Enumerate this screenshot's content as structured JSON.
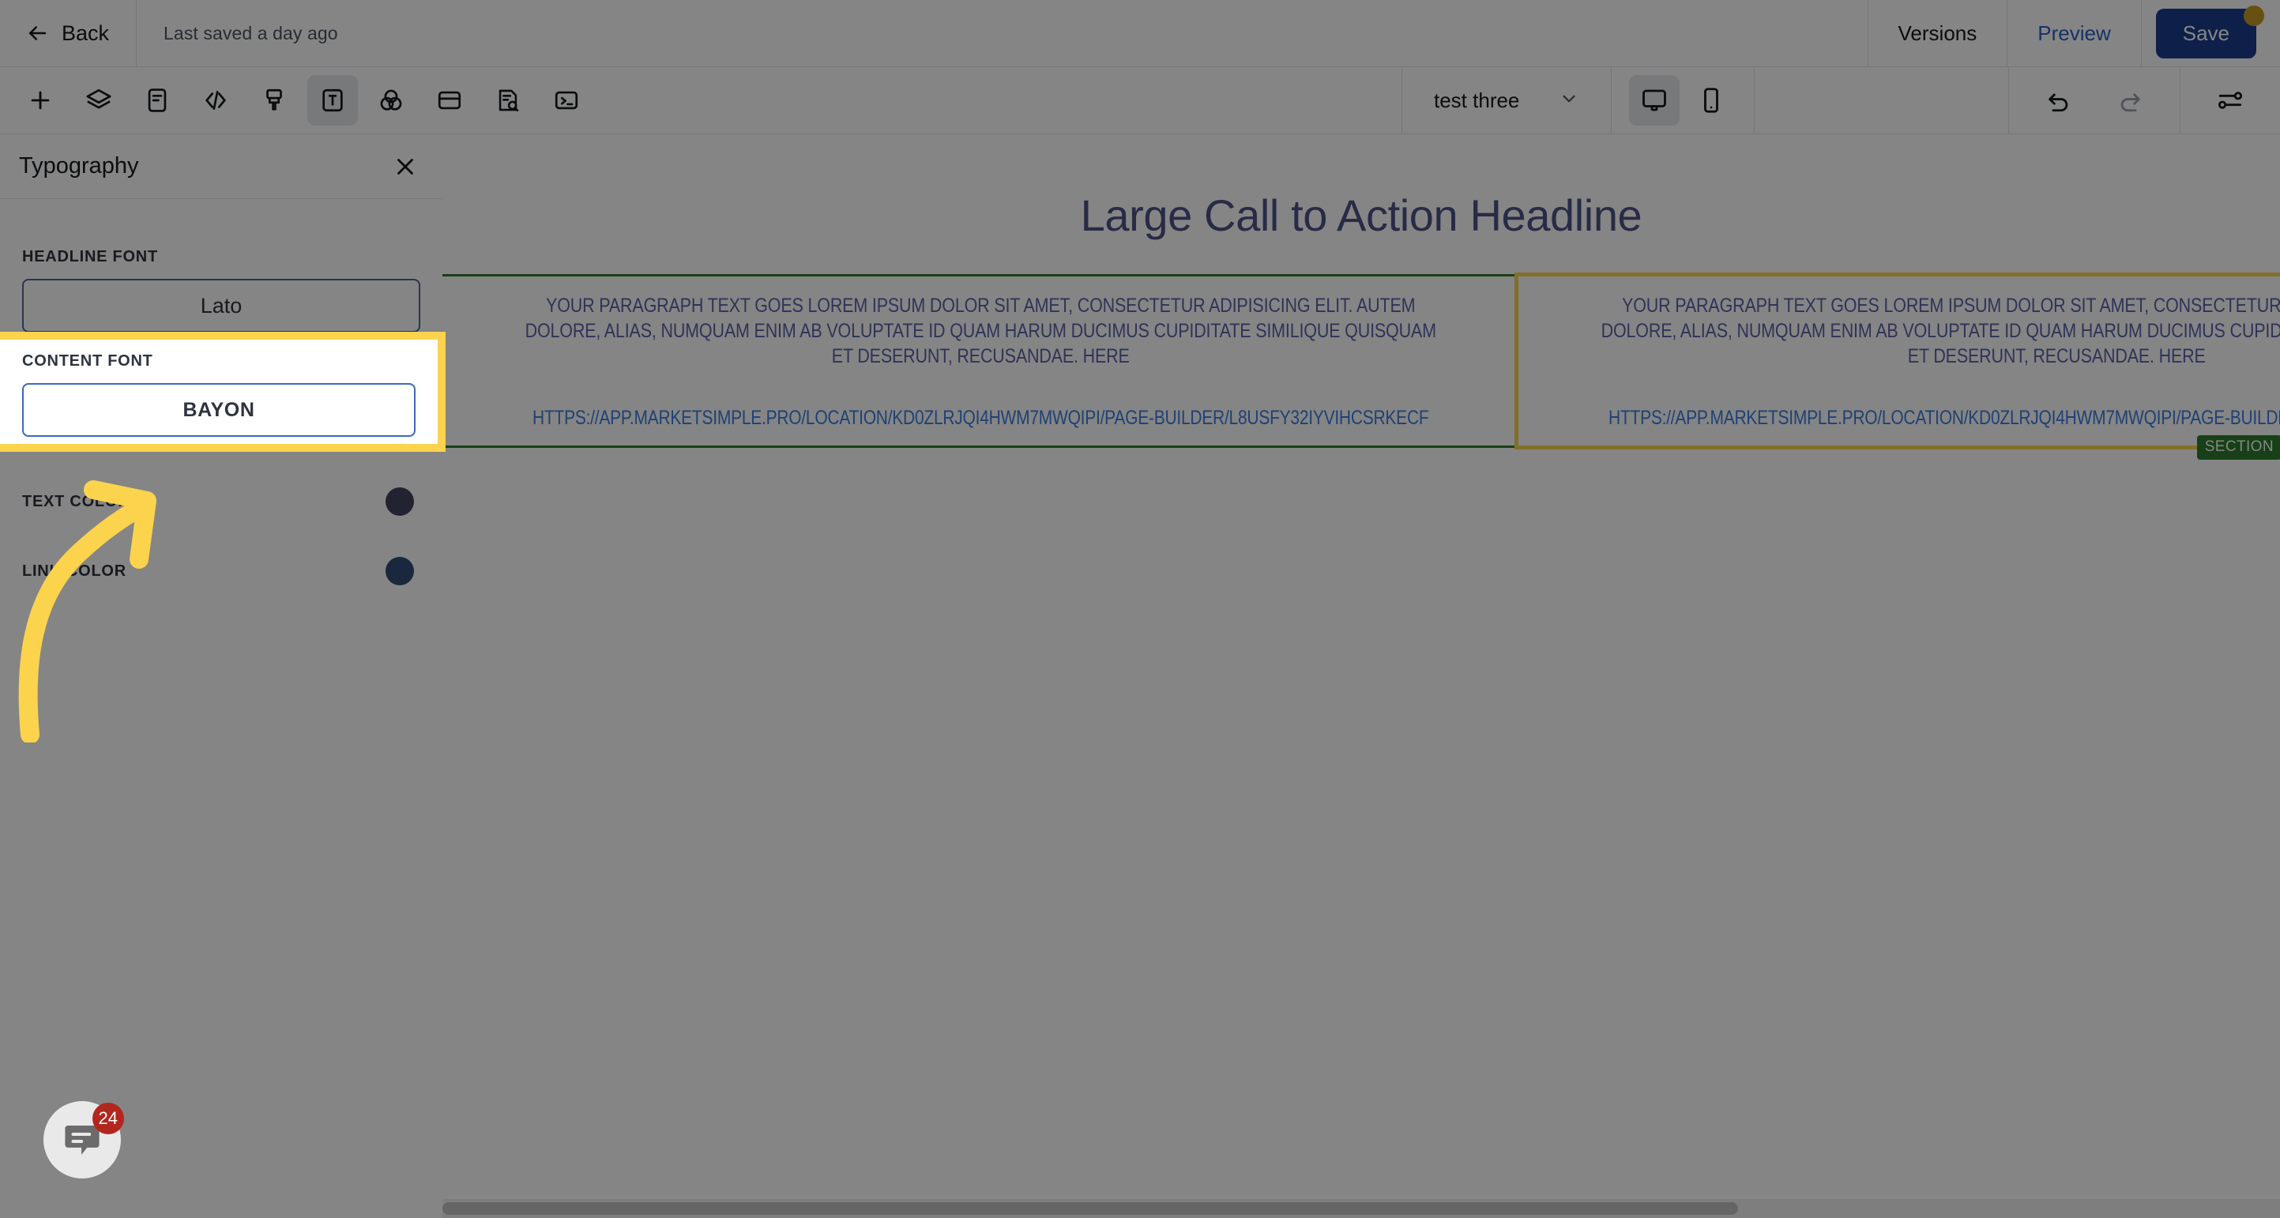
{
  "topbar": {
    "back_label": "Back",
    "back_icon": "arrow-left-icon",
    "saved_status": "Last saved a day ago",
    "versions_label": "Versions",
    "preview_label": "Preview",
    "save_label": "Save",
    "save_button_color": "#1b3e8f",
    "unsaved_dot_color": "#c89a24"
  },
  "toolbar": {
    "tools": [
      {
        "name": "add-element-icon",
        "active": false
      },
      {
        "name": "layers-icon",
        "active": false
      },
      {
        "name": "document-icon",
        "active": false
      },
      {
        "name": "code-icon",
        "active": false
      },
      {
        "name": "brush-icon",
        "active": false
      },
      {
        "name": "typography-icon",
        "active": true
      },
      {
        "name": "color-blend-icon",
        "active": false
      },
      {
        "name": "card-icon",
        "active": false
      },
      {
        "name": "seo-audit-icon",
        "active": false
      },
      {
        "name": "terminal-icon",
        "active": false
      }
    ],
    "page_name": "test three",
    "page_chevron_icon": "chevron-down-icon",
    "desktop_view_icon": "desktop-icon",
    "mobile_view_icon": "mobile-icon",
    "desktop_active": true,
    "undo_icon": "undo-icon",
    "redo_icon": "redo-icon",
    "settings_icon": "sliders-icon"
  },
  "panel": {
    "title": "Typography",
    "close_icon": "close-icon",
    "headline_font_label": "HEADLINE FONT",
    "headline_font_value": "Lato",
    "content_font_label": "CONTENT FONT",
    "content_font_value": "BAYON",
    "text_color_label": "TEXT COLOR",
    "text_color_value": "#3f4370",
    "link_color_label": "LINK COLOR",
    "link_color_value": "#1f4f90",
    "highlight_color": "#fcd34d"
  },
  "canvas": {
    "headline": "Large Call to Action Headline",
    "headline_color": "#4d5387",
    "section_badge": "SECTION",
    "section_outline_color": "#2f7b2f",
    "paragraph": "Your paragraph text goes Lorem ipsum dolor sit amet, consectetur adipisicing elit. Autem dolore, alias, numquam enim ab voluptate id quam harum ducimus cupiditate similique quisquam et deserunt, recusandae. Here",
    "link_text": "https://app.marketsimple.pro/location/kd0zlrjqi4hwm7mwqipi/page-builder/l8usfy32iyvihcsrkecf",
    "paragraph_color": "#5b62a8",
    "link_color": "#3b7de0",
    "highlight_color": "#fcd34d"
  },
  "chat": {
    "icon": "chat-bubble-icon",
    "unread_count": "24",
    "badge_color": "#b3261e"
  }
}
